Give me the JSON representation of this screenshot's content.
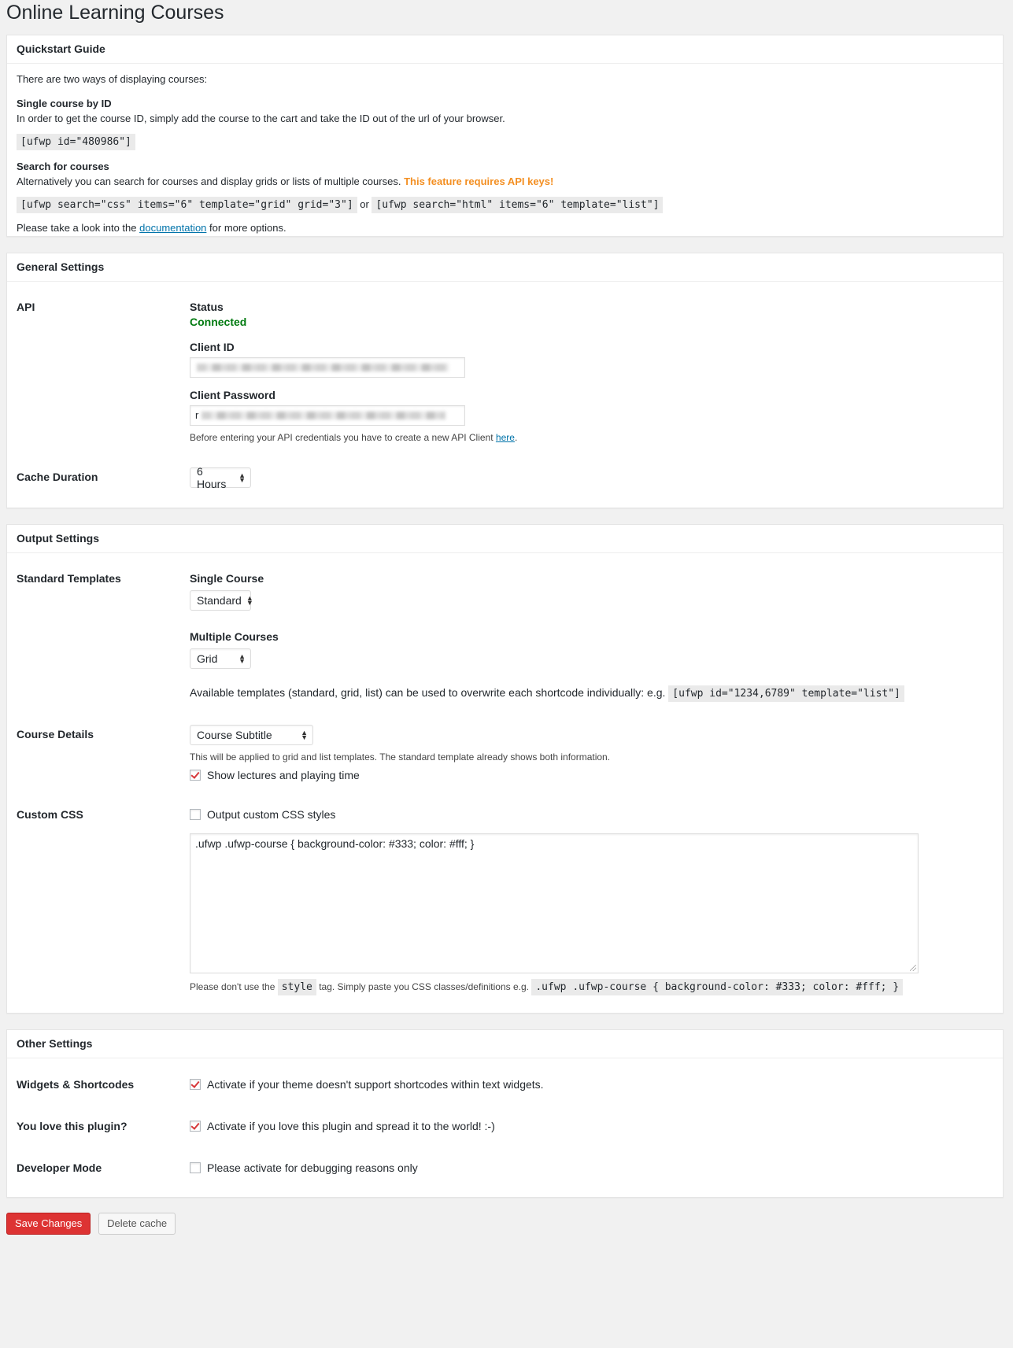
{
  "page": {
    "title": "Online Learning Courses"
  },
  "quickstart": {
    "heading": "Quickstart Guide",
    "intro": "There are two ways of displaying courses:",
    "single_title": "Single course by ID",
    "single_desc": "In order to get the course ID, simply add the course to the cart and take the ID out of the url of your browser.",
    "single_code": "[ufwp id=\"480986\"]",
    "search_title": "Search for courses",
    "search_desc": "Alternatively you can search for courses and display grids or lists of multiple courses.",
    "search_warning": "This feature requires API keys!",
    "search_code_1": "[ufwp search=\"css\" items=\"6\" template=\"grid\" grid=\"3\"]",
    "search_or": "or",
    "search_code_2": "[ufwp search=\"html\" items=\"6\" template=\"list\"]",
    "docs_prefix": "Please take a look into the",
    "docs_link": "documentation",
    "docs_suffix": "for more options."
  },
  "general": {
    "heading": "General Settings",
    "api_label": "API",
    "status_label": "Status",
    "status_value": "Connected",
    "client_id_label": "Client ID",
    "client_password_label": "Client Password",
    "password_first_char": "r",
    "api_note_prefix": "Before entering your API credentials you have to create a new API Client",
    "api_note_link": "here",
    "api_note_suffix": ".",
    "cache_label": "Cache Duration",
    "cache_value": "6 Hours"
  },
  "output": {
    "heading": "Output Settings",
    "templates_label": "Standard Templates",
    "single_label": "Single Course",
    "single_value": "Standard",
    "multiple_label": "Multiple Courses",
    "multiple_value": "Grid",
    "templates_note": "Available templates (standard, grid, list) can be used to overwrite each shortcode individually: e.g.",
    "templates_code": "[ufwp id=\"1234,6789\" template=\"list\"]",
    "details_label": "Course Details",
    "details_value": "Course Subtitle",
    "details_note": "This will be applied to grid and list templates. The standard template already shows both information.",
    "lectures_label": "Show lectures and playing time",
    "lectures_checked": true,
    "css_label": "Custom CSS",
    "css_checkbox_label": "Output custom CSS styles",
    "css_checked": false,
    "css_textarea_value": ".ufwp .ufwp-course { background-color: #333; color: #fff; }",
    "css_note_prefix": "Please don't use the",
    "css_note_code": "style",
    "css_note_middle": "tag. Simply paste you CSS classes/definitions e.g.",
    "css_note_code_2": ".ufwp .ufwp-course { background-color: #333; color: #fff; }"
  },
  "other": {
    "heading": "Other Settings",
    "widgets_label": "Widgets & Shortcodes",
    "widgets_text": "Activate if your theme doesn't support shortcodes within text widgets.",
    "widgets_checked": true,
    "love_label": "You love this plugin?",
    "love_text": "Activate if you love this plugin and spread it to the world! :-)",
    "love_checked": true,
    "dev_label": "Developer Mode",
    "dev_text": "Please activate for debugging reasons only",
    "dev_checked": false
  },
  "actions": {
    "save_label": "Save Changes",
    "delete_label": "Delete cache"
  },
  "colors": {
    "connected": "#007a10",
    "warning": "#f38f22",
    "primary_button": "#dd3333",
    "check_mark": "#d63638"
  }
}
